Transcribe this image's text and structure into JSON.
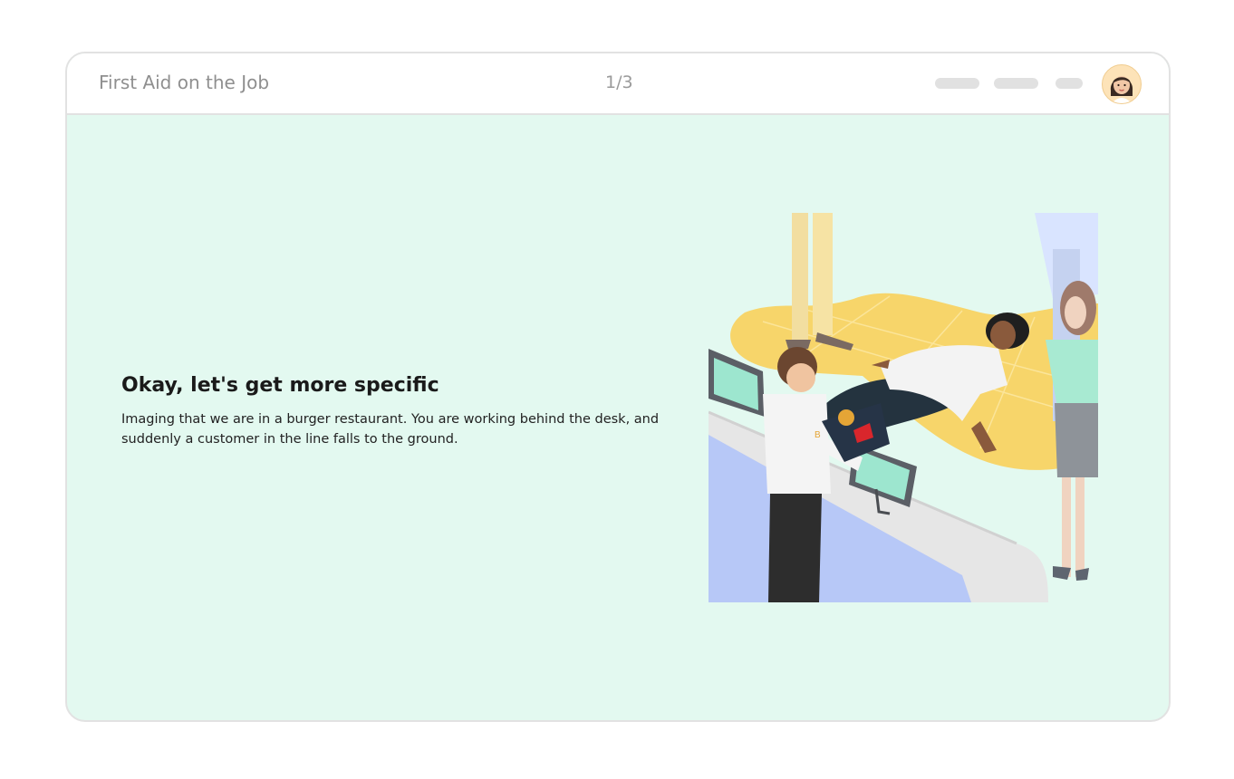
{
  "header": {
    "course_title": "First Aid on the Job",
    "progress": "1/3",
    "avatar_icon": "user-avatar-icon"
  },
  "slide": {
    "heading": "Okay, let's get more specific",
    "body": "Imaging that we are in a burger restaurant. You are working behind the desk, and suddenly a customer in the line falls to the ground.",
    "illustration_icon": "burger-restaurant-scene-illustration"
  },
  "colors": {
    "page_background": "#ffffff",
    "content_background": "#e3f9f0",
    "floor_yellow": "#f7d56a",
    "counter_blue": "#b7c8f7"
  }
}
